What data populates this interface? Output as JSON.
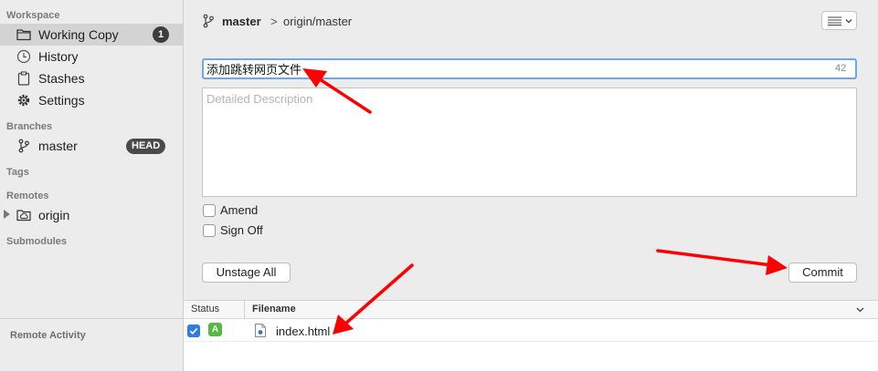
{
  "sidebar": {
    "workspace_title": "Workspace",
    "workspace_items": [
      {
        "label": "Working Copy",
        "badge": "1",
        "icon": "folder-icon"
      },
      {
        "label": "History",
        "icon": "clock-icon"
      },
      {
        "label": "Stashes",
        "icon": "clipboard-icon"
      },
      {
        "label": "Settings",
        "icon": "gear-icon"
      }
    ],
    "branches_title": "Branches",
    "branches": [
      {
        "label": "master",
        "badge": "HEAD",
        "icon": "branch-icon"
      }
    ],
    "tags_title": "Tags",
    "remotes_title": "Remotes",
    "remotes": [
      {
        "label": "origin",
        "icon": "cloud-folder-icon"
      }
    ],
    "submodules_title": "Submodules",
    "remote_activity": "Remote Activity"
  },
  "header": {
    "branch": "master",
    "separator": ">",
    "remote_branch": "origin/master"
  },
  "commit": {
    "summary_value": "添加跳转网页文件",
    "char_count": "42",
    "description_placeholder": "Detailed Description",
    "amend_label": "Amend",
    "amend_checked": false,
    "signoff_label": "Sign Off",
    "signoff_checked": false,
    "unstage_all_label": "Unstage All",
    "commit_label": "Commit"
  },
  "files": {
    "columns": [
      "Status",
      "Filename"
    ],
    "rows": [
      {
        "checked": true,
        "status": "A",
        "filename": "index.html"
      }
    ]
  },
  "colors": {
    "accent_blue": "#2f7de1",
    "added_green": "#56b947",
    "annotation_red": "#ff0000",
    "badge_dark": "#3d3d3d"
  }
}
